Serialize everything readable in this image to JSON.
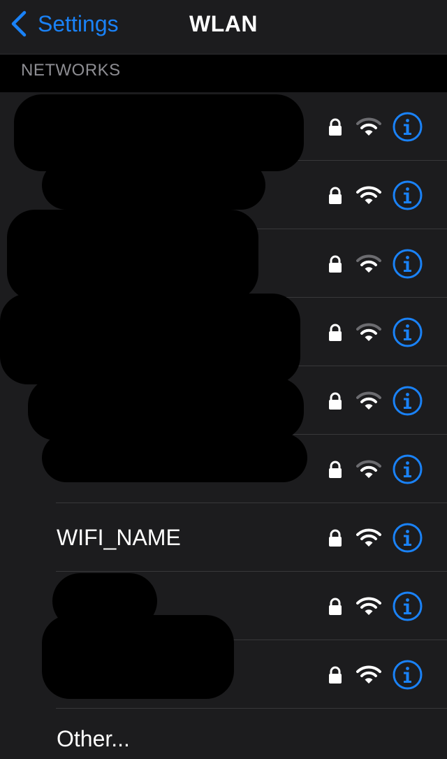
{
  "navbar": {
    "back_label": "Settings",
    "title": "WLAN"
  },
  "section": {
    "header": "NETWORKS"
  },
  "networks": [
    {
      "name": "",
      "locked": true,
      "signal": 2
    },
    {
      "name": "",
      "locked": true,
      "signal": 3
    },
    {
      "name": "",
      "locked": true,
      "signal": 2
    },
    {
      "name": "",
      "locked": true,
      "signal": 2
    },
    {
      "name": "",
      "locked": true,
      "signal": 2
    },
    {
      "name": "",
      "locked": true,
      "signal": 2
    },
    {
      "name": "WIFI_NAME",
      "locked": true,
      "signal": 3
    },
    {
      "name": "",
      "locked": true,
      "signal": 3
    },
    {
      "name": "",
      "locked": true,
      "signal": 3
    }
  ],
  "other": {
    "label": "Other..."
  },
  "colors": {
    "accent": "#1a82f7",
    "background": "#1c1c1e"
  },
  "icons": {
    "lock": "lock-icon",
    "wifi": "wifi-icon",
    "info": "info-icon"
  }
}
